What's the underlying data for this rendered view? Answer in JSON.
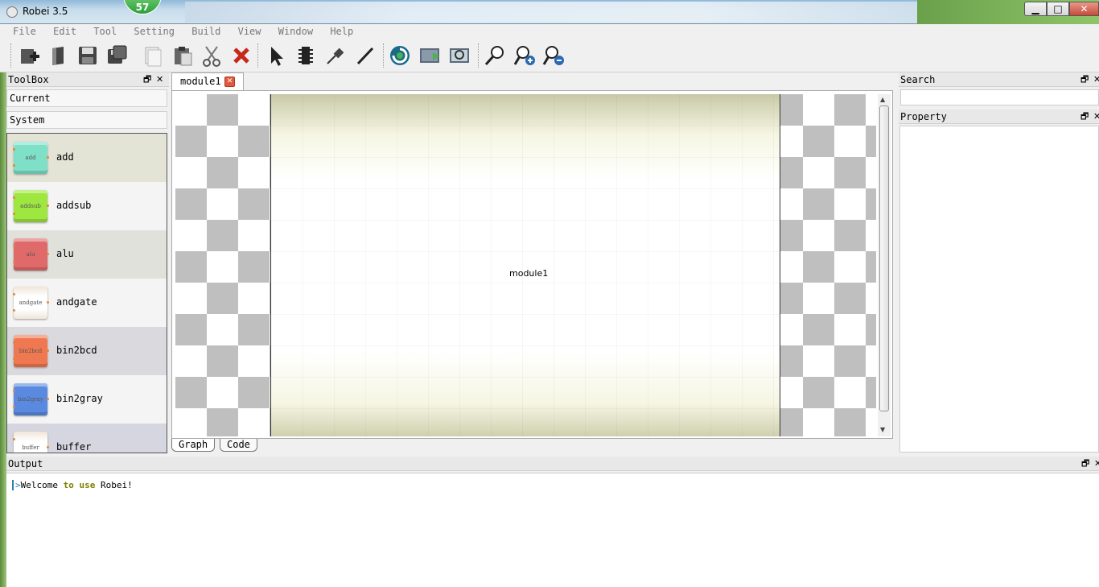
{
  "window": {
    "title": "Robei 3.5",
    "notification_count": "57",
    "minimize": "▁",
    "maximize": "□",
    "close": "✕"
  },
  "menu": [
    "File",
    "Edit",
    "Tool",
    "Setting",
    "Build",
    "View",
    "Window",
    "Help"
  ],
  "toolbar_icons": [
    "new-icon",
    "open-icon",
    "save-icon",
    "save-all-icon",
    "copy-icon",
    "paste-icon",
    "cut-icon",
    "delete-icon",
    "select-icon",
    "chip-icon",
    "probe-icon",
    "wire-icon",
    "compile-icon",
    "run-icon",
    "preview-icon",
    "find-icon",
    "zoom-in-icon",
    "zoom-out-icon"
  ],
  "toolbox": {
    "title": "ToolBox",
    "float": "🗗",
    "close": "✕",
    "sections": [
      "Current",
      "System"
    ],
    "items": [
      {
        "thumb": "add",
        "label": "add",
        "color": "#7fe0c8",
        "bg": "#e3e3d6"
      },
      {
        "thumb": "addsub",
        "label": "addsub",
        "color": "#9ee640",
        "bg": "#f4f4f4"
      },
      {
        "thumb": "alu",
        "label": "alu",
        "color": "#e06a6a",
        "bg": "#e1e1dc"
      },
      {
        "thumb": "andgate",
        "label": "andgate",
        "color": "#f0e6d8",
        "bg": "#f4f4f4"
      },
      {
        "thumb": "bin2bcd",
        "label": "bin2bcd",
        "color": "#f07850",
        "bg": "#d9d9de"
      },
      {
        "thumb": "bin2gray",
        "label": "bin2gray",
        "color": "#5a8ae0",
        "bg": "#f4f4f4"
      },
      {
        "thumb": "buffer",
        "label": "buffer",
        "color": "#f0e6d8",
        "bg": "#d6d6e0"
      }
    ]
  },
  "editor": {
    "tab_label": "module1",
    "tab_close": "✕",
    "module_name": "module1",
    "bottom_tabs": [
      "Graph",
      "Code"
    ]
  },
  "search": {
    "title": "Search",
    "float": "🗗",
    "close": "✕"
  },
  "property": {
    "title": "Property",
    "float": "🗗",
    "close": "✕"
  },
  "output": {
    "title": "Output",
    "float": "🗗",
    "close": "✕",
    "prompt": ">",
    "text_1": "Welcome ",
    "kw_1": "to use",
    "text_2": " Robei!"
  }
}
